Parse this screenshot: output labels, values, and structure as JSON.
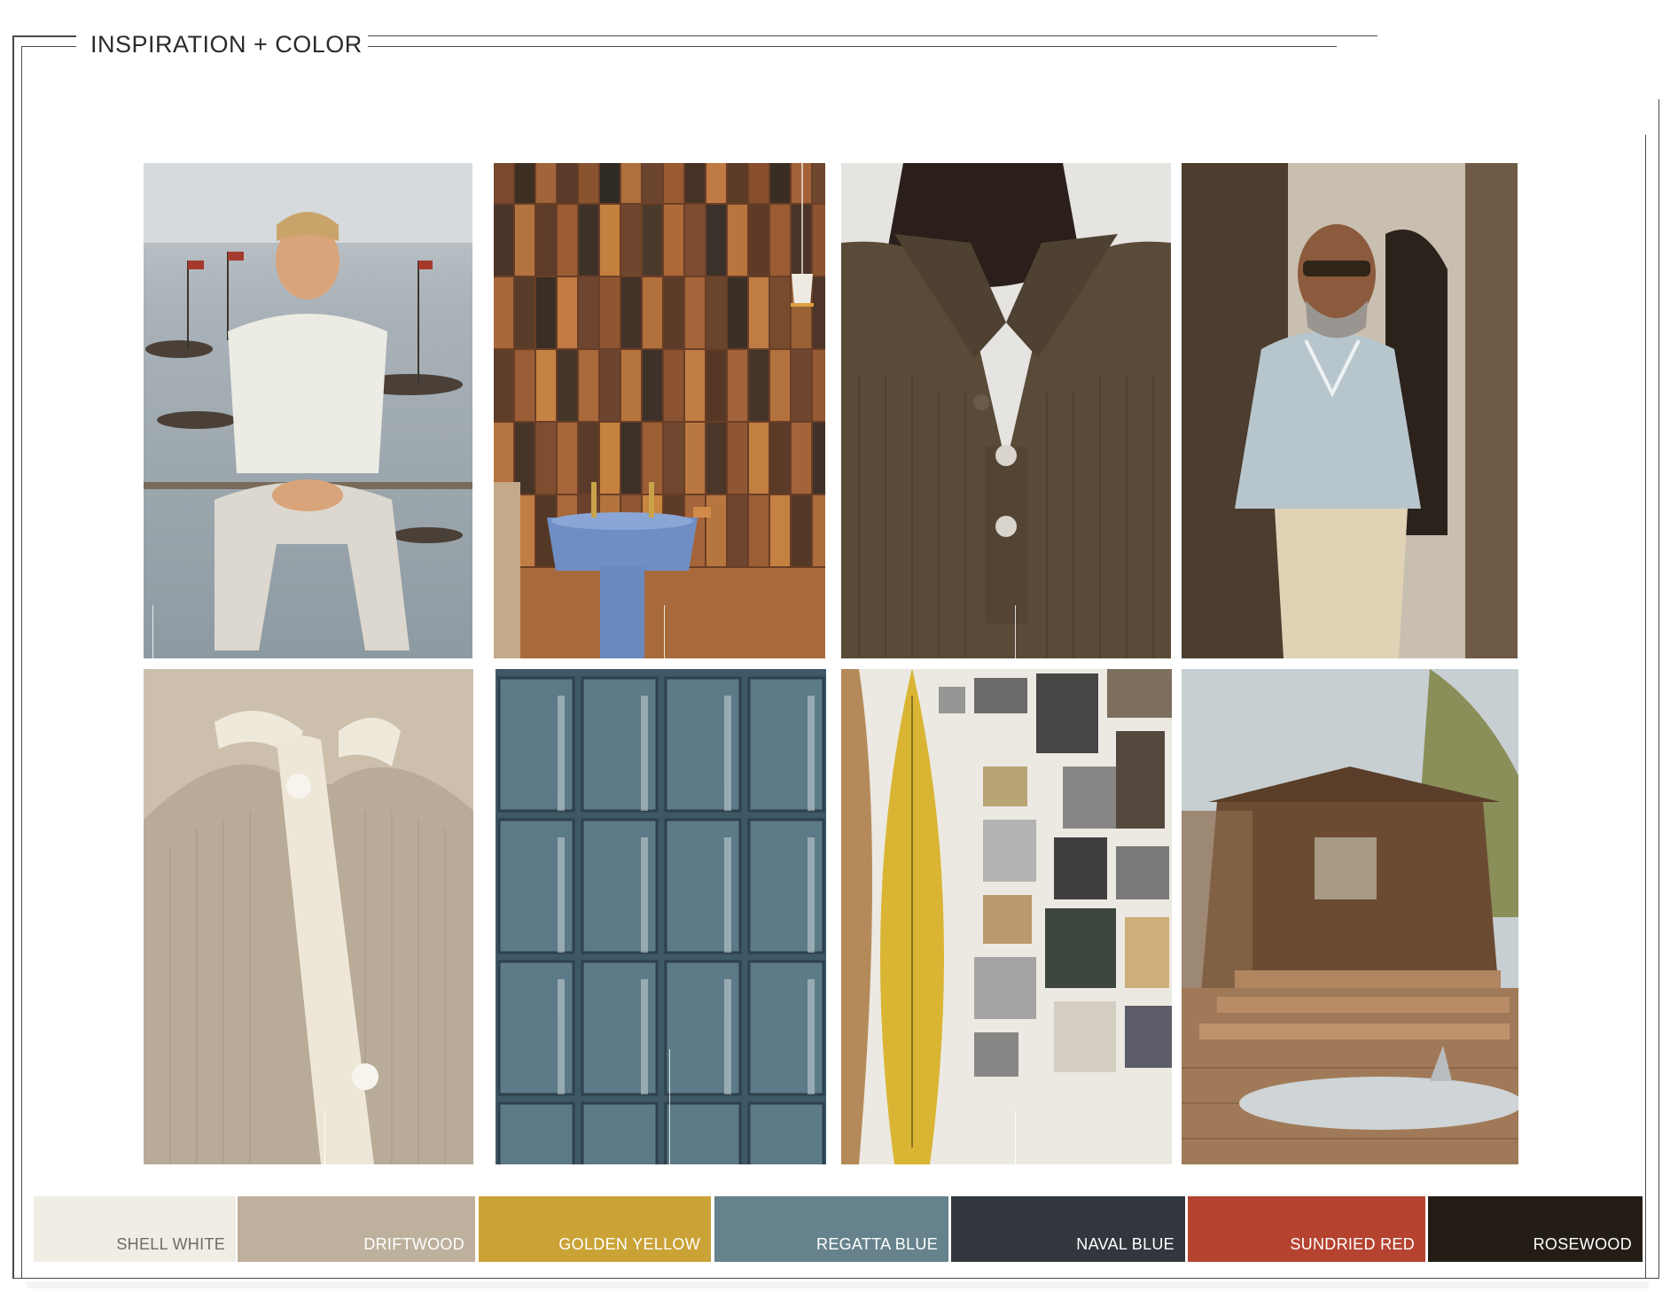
{
  "header": {
    "title": "INSPIRATION + COLOR"
  },
  "images": [
    {
      "id": "man-white-tee",
      "description_name": "man-in-white-tee-on-harbor"
    },
    {
      "id": "tile-sink",
      "description_name": "brown-tile-wall-blue-sink"
    },
    {
      "id": "knit-polo",
      "description_name": "olive-knit-polo-closeup"
    },
    {
      "id": "man-blue-polo",
      "description_name": "man-in-light-blue-polo"
    },
    {
      "id": "beige-knit",
      "description_name": "beige-knit-cardigan-closeup"
    },
    {
      "id": "blue-tiles",
      "description_name": "blue-glazed-tiles"
    },
    {
      "id": "surf-wall",
      "description_name": "yellow-surfboard-photo-wall"
    },
    {
      "id": "cabin-deck",
      "description_name": "wooden-cabin-deck-surfboard"
    }
  ],
  "palette": [
    {
      "label": "SHELL WHITE",
      "color": "#f0ede4",
      "text_color": "#6e6b66"
    },
    {
      "label": "DRIFTWOOD",
      "color": "#bdb19d",
      "text_color": "#ffffff"
    },
    {
      "label": "GOLDEN YELLOW",
      "color": "#caa236",
      "text_color": "#ffffff"
    },
    {
      "label": "REGATTA BLUE",
      "color": "#66828c",
      "text_color": "#ffffff"
    },
    {
      "label": "NAVAL BLUE",
      "color": "#32363d",
      "text_color": "#ffffff"
    },
    {
      "label": "SUNDRIED RED",
      "color": "#b54330",
      "text_color": "#ffffff"
    },
    {
      "label": "ROSEWOOD",
      "color": "#231d16",
      "text_color": "#ffffff"
    }
  ]
}
